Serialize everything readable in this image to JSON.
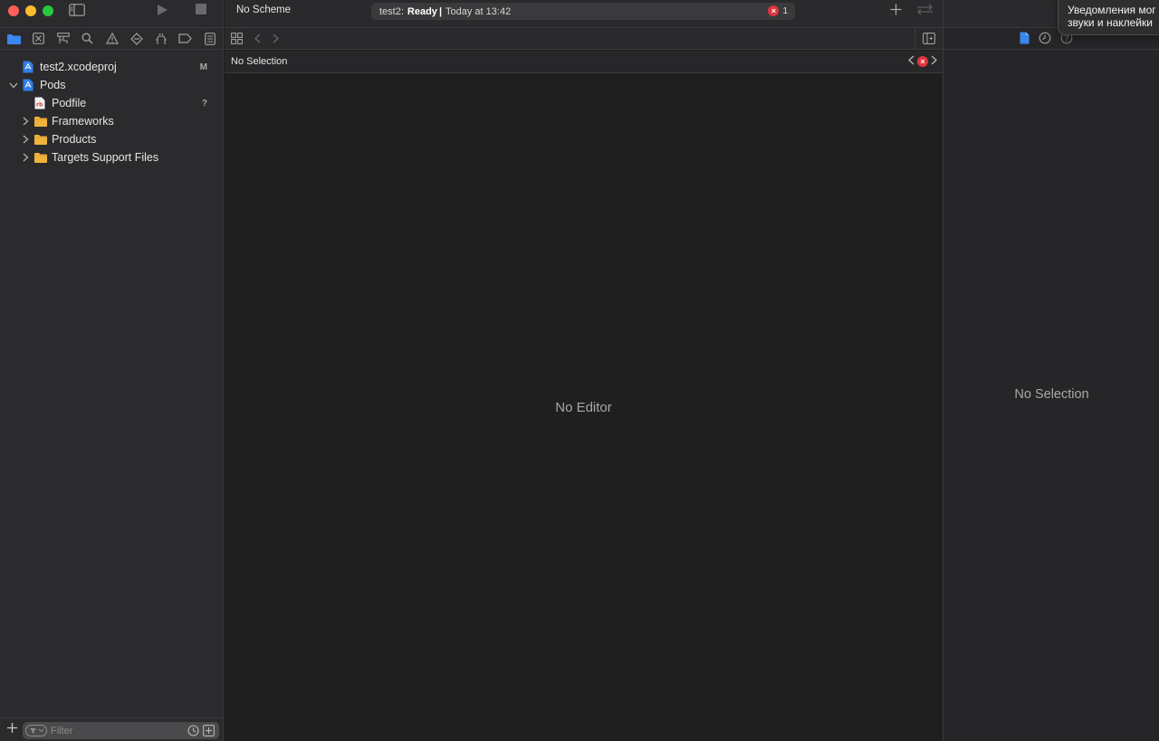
{
  "toolbar": {
    "scheme": "No Scheme",
    "activity": {
      "project": "test2:",
      "status": "Ready",
      "separator": "|",
      "time": "Today at 13:42",
      "error_count": "1"
    }
  },
  "navigator": {
    "items": [
      {
        "label": "test2.xcodeproj",
        "badge": "M",
        "icon": "xcodeproj-icon",
        "expanded": null,
        "indent": 0
      },
      {
        "label": "Pods",
        "badge": "",
        "icon": "xcodeproj-icon",
        "expanded": true,
        "indent": 0
      },
      {
        "label": "Podfile",
        "badge": "?",
        "icon": "ruby-file-icon",
        "expanded": null,
        "indent": 1
      },
      {
        "label": "Frameworks",
        "badge": "",
        "icon": "folder-icon",
        "expanded": false,
        "indent": 1
      },
      {
        "label": "Products",
        "badge": "",
        "icon": "folder-icon",
        "expanded": false,
        "indent": 1
      },
      {
        "label": "Targets Support Files",
        "badge": "",
        "icon": "folder-icon",
        "expanded": false,
        "indent": 1
      }
    ],
    "filter_placeholder": "Filter"
  },
  "jumpbar": {
    "crumb": "No Selection"
  },
  "editor": {
    "empty_text": "No Editor"
  },
  "inspector": {
    "empty_text": "No Selection"
  },
  "notification": {
    "line1": "Уведомления мог",
    "line2": "звуки и наклейки"
  },
  "colors": {
    "accent": "#1e6fd9",
    "folder": "#f0b43c",
    "error": "#e0353d"
  }
}
